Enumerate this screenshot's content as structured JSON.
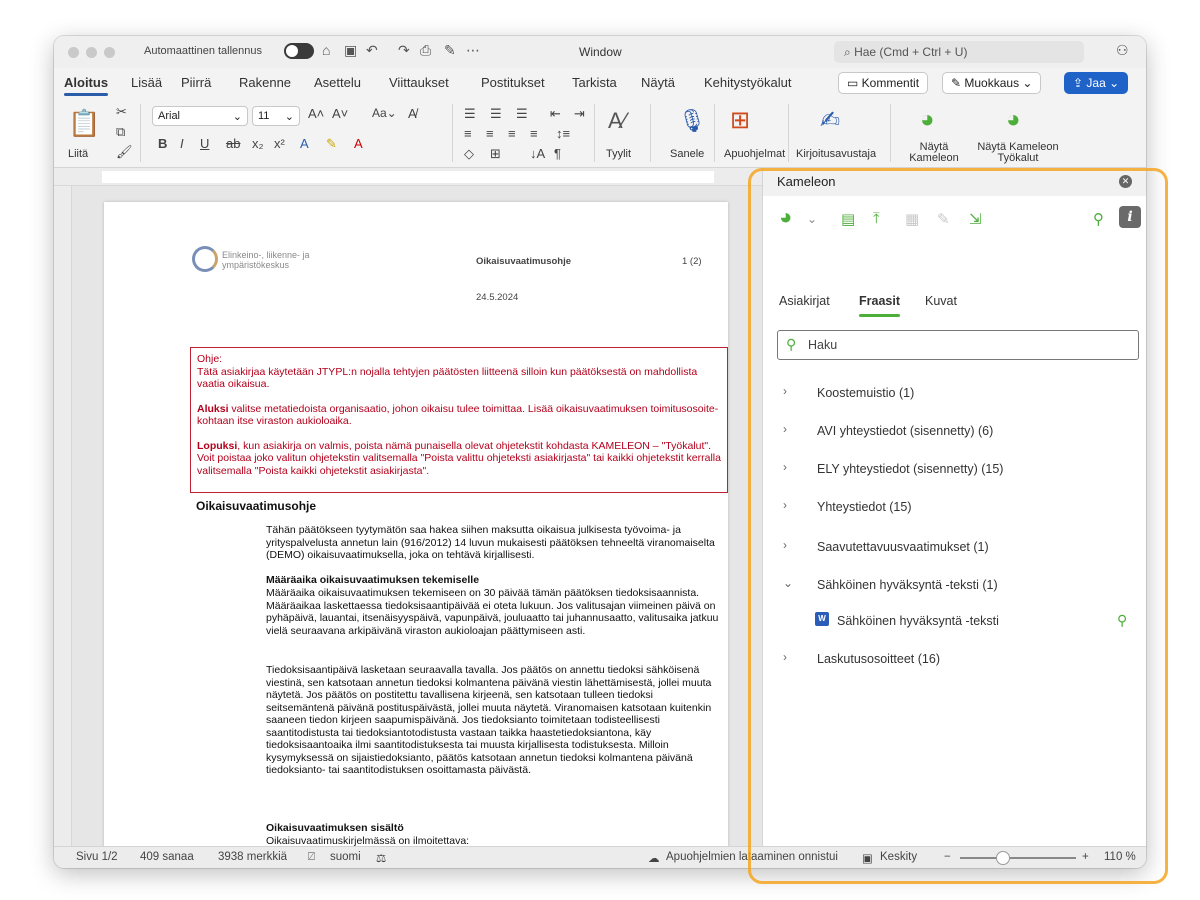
{
  "titlebar": {
    "autosave_label": "Automaattinen tallennus",
    "window_title": "Window",
    "search_placeholder": "Hae (Cmd + Ctrl + U)"
  },
  "tabs": [
    "Aloitus",
    "Lisää",
    "Piirrä",
    "Rakenne",
    "Asettelu",
    "Viittaukset",
    "Postitukset",
    "Tarkista",
    "Näytä",
    "Kehitystyökalut"
  ],
  "tab_buttons": {
    "comments": "Kommentit",
    "editing": "Muokkaus",
    "share": "Jaa"
  },
  "ribbon": {
    "paste": "Liitä",
    "font_name": "Arial",
    "font_size": "11",
    "styles": "Tyylit",
    "dictate": "Sanele",
    "addins": "Apuohjelmat",
    "writing_assistant": "Kirjoitusavustaja",
    "show_kameleon": "Näytä Kameleon",
    "show_kameleon_tools": "Näytä Kameleon Työkalut"
  },
  "document": {
    "org_name": "Elinkeino-, liikenne- ja ympäristökeskus",
    "doc_type": "Oikaisuvaatimusohje",
    "page_count": "1 (2)",
    "date": "24.5.2024",
    "ohje_label": "Ohje:",
    "ohje_line1": "Tätä asiakirjaa käytetään JTYPL:n nojalla tehtyjen päätösten liitteenä silloin kun päätöksestä on mahdollista vaatia oikaisua.",
    "aluksi_bold": "Aluksi",
    "aluksi_text": " valitse metatiedoista organisaatio, johon oikaisu tulee toimittaa. Lisää oikaisuvaatimuksen toimitusosoite-kohtaan itse viraston aukioloaika.",
    "lopuksi_bold": "Lopuksi",
    "lopuksi_text": ", kun asiakirja on valmis, poista nämä punaisella olevat ohjetekstit kohdasta KAMELEON – \"Työkalut\". Voit poistaa joko valitun ohjetekstin valitsemalla \"Poista valittu ohjeteksti asiakirjasta\" tai kaikki ohjetekstit kerralla valitsemalla \"Poista kaikki ohjetekstit asiakirjasta\".",
    "heading": "Oikaisuvaatimusohje",
    "para1": "Tähän päätökseen tyytymätön saa hakea siihen maksutta oikaisua julkisesta työvoima- ja yrityspalvelusta annetun lain (916/2012) 14 luvun mukaisesti päätöksen tehneeltä viranomaiselta (DEMO) oikaisuvaatimuksella, joka on tehtävä kirjallisesti.",
    "sub1": "Määräaika oikaisuvaatimuksen tekemiselle",
    "para2": "Määräaika oikaisuvaatimuksen tekemiseen on 30 päivää tämän päätöksen tiedoksisaannista. Määräaikaa laskettaessa tiedoksisaantipäivää ei oteta lukuun. Jos valitusajan viimeinen päivä on pyhäpäivä, lauantai, itsenäisyyspäivä, vapunpäivä, jouluaatto tai juhannusaatto, valitusaika jatkuu vielä seuraavana arkipäivänä viraston aukioloajan päättymiseen asti.",
    "para3": "Tiedoksisaantipäivä lasketaan seuraavalla tavalla. Jos päätös on annettu tiedoksi sähköisenä viestinä, sen katsotaan annetun tiedoksi kolmantena päivänä viestin lähettämisestä, jollei muuta näytetä. Jos päätös on postitettu tavallisena kirjeenä, sen katsotaan tulleen tiedoksi seitsemäntenä päivänä postituspäivästä, jollei muuta näytetä. Viranomaisen katsotaan kuitenkin saaneen tiedon kirjeen saapumispäivänä. Jos tiedoksianto toimitetaan todisteellisesti saantitodistusta tai tiedoksiantotodistusta vastaan taikka haastetiedoksiantona, käy tiedoksisaantoaika ilmi saantitodistuksesta tai muusta kirjallisesta todistuksesta. Milloin kysymyksessä on sijaistiedoksianto, päätös katsotaan annetun tiedoksi kolmantena päivänä tiedoksianto- tai saantitodistuksen osoittamasta päivästä.",
    "sub2": "Oikaisuvaatimuksen sisältö",
    "para4": "Oikaisuvaatimuskirjelmässä on ilmoitettava:"
  },
  "pane": {
    "title": "Kameleon",
    "tabs": [
      "Asiakirjat",
      "Fraasit",
      "Kuvat"
    ],
    "search_placeholder": "Haku",
    "items": [
      "Koostemuistio (1)",
      "AVI yhteystiedot (sisennetty) (6)",
      "ELY yhteystiedot (sisennetty) (15)",
      "Yhteystiedot (15)",
      "Saavutettavuusvaatimukset (1)",
      "Sähköinen hyväksyntä -teksti (1)",
      "Laskutusosoitteet (16)"
    ],
    "subitem": "Sähköinen hyväksyntä -teksti"
  },
  "status": {
    "page": "Sivu 1/2",
    "words": "409 sanaa",
    "chars": "3938 merkkiä",
    "language": "suomi",
    "addins_msg": "Apuohjelmien lataaminen onnistui",
    "focus": "Keskity",
    "zoom": "110 %"
  },
  "colors": {
    "accent_green": "#4caf3a",
    "share_blue": "#1f63c9",
    "highlight_orange": "#f5a623",
    "instruction_red": "#b3001b"
  }
}
